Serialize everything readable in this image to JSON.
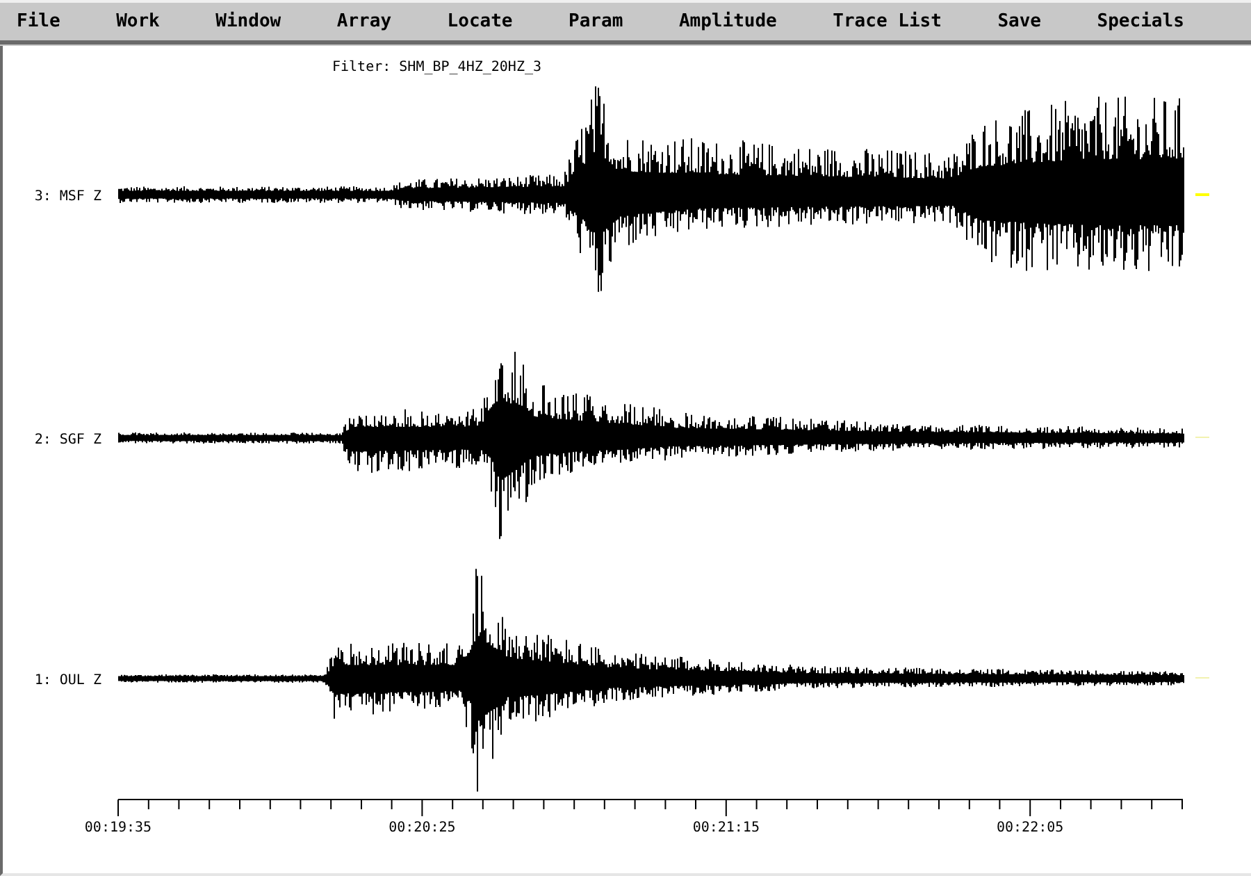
{
  "menu": [
    "File",
    "Work",
    "Window",
    "Array",
    "Locate",
    "Param",
    "Amplitude",
    "Trace List",
    "Save",
    "Specials"
  ],
  "filter": "Filter: SHM_BP_4HZ_20HZ_3",
  "traces": [
    {
      "label": "3: MSF Z",
      "selected": true
    },
    {
      "label": "2: SGF Z",
      "selected": false
    },
    {
      "label": "1: OUL Z",
      "selected": false
    }
  ],
  "time_axis": {
    "labels": [
      "00:19:35",
      "00:20:25",
      "00:21:15",
      "00:22:05"
    ]
  }
}
